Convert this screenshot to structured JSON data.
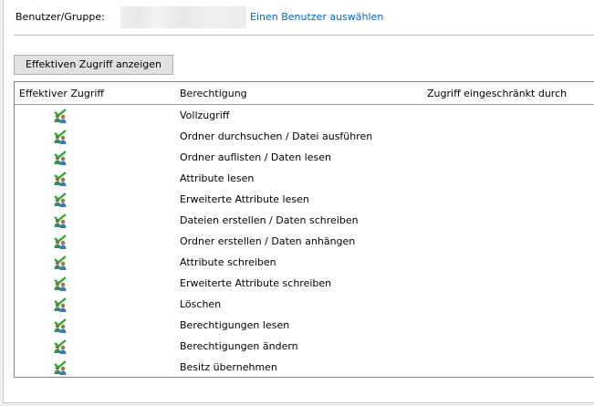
{
  "header": {
    "user_group_label": "Benutzer/Gruppe:",
    "select_user_link": "Einen Benutzer auswählen"
  },
  "button": {
    "show_effective_access": "Effektiven Zugriff anzeigen"
  },
  "table": {
    "columns": [
      "Effektiver Zugriff",
      "Berechtigung",
      "Zugriff eingeschränkt durch"
    ],
    "rows": [
      {
        "icon": "users-allowed-icon",
        "permission": "Vollzugriff"
      },
      {
        "icon": "users-allowed-icon",
        "permission": "Ordner durchsuchen / Datei ausführen"
      },
      {
        "icon": "users-allowed-icon",
        "permission": "Ordner auflisten / Daten lesen"
      },
      {
        "icon": "users-allowed-icon",
        "permission": "Attribute lesen"
      },
      {
        "icon": "users-allowed-icon",
        "permission": "Erweiterte Attribute lesen"
      },
      {
        "icon": "users-allowed-icon",
        "permission": "Dateien erstellen / Daten schreiben"
      },
      {
        "icon": "users-allowed-icon",
        "permission": "Ordner erstellen / Daten anhängen"
      },
      {
        "icon": "users-allowed-icon",
        "permission": "Attribute schreiben"
      },
      {
        "icon": "users-allowed-icon",
        "permission": "Erweiterte Attribute schreiben"
      },
      {
        "icon": "users-allowed-icon",
        "permission": "Löschen"
      },
      {
        "icon": "users-allowed-icon",
        "permission": "Berechtigungen lesen"
      },
      {
        "icon": "users-allowed-icon",
        "permission": "Berechtigungen ändern"
      },
      {
        "icon": "users-allowed-icon",
        "permission": "Besitz übernehmen"
      }
    ]
  },
  "colors": {
    "link": "#0066cc",
    "check": "#2fa52f"
  }
}
